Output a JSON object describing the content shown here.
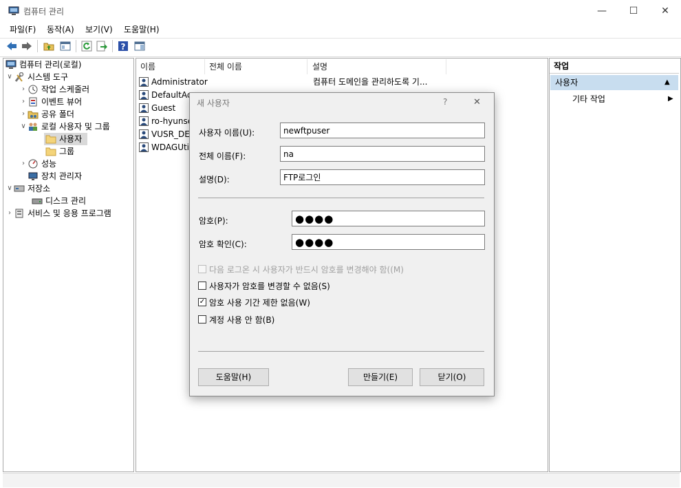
{
  "window": {
    "title": "컴퓨터 관리"
  },
  "window_controls": {
    "minimize": "—",
    "maximize": "☐",
    "close": "✕"
  },
  "menu": [
    "파일(F)",
    "동작(A)",
    "보기(V)",
    "도움말(H)"
  ],
  "tree": [
    {
      "label": "컴퓨터 관리(로컬)",
      "arrow": "",
      "icon": "computer-management-icon"
    },
    {
      "label": "시스템 도구",
      "arrow": "∨",
      "icon": "tools-icon"
    },
    {
      "label": "작업 스케줄러",
      "arrow": "›",
      "icon": "clock-icon"
    },
    {
      "label": "이벤트 뷰어",
      "arrow": "›",
      "icon": "event-viewer-icon"
    },
    {
      "label": "공유 폴더",
      "arrow": "›",
      "icon": "shared-folder-icon"
    },
    {
      "label": "로컬 사용자 및 그룹",
      "arrow": "∨",
      "icon": "users-group-icon"
    },
    {
      "label": "사용자",
      "arrow": "",
      "icon": "folder-icon"
    },
    {
      "label": "그룹",
      "arrow": "",
      "icon": "folder-icon"
    },
    {
      "label": "성능",
      "arrow": "›",
      "icon": "performance-icon"
    },
    {
      "label": "장치 관리자",
      "arrow": "",
      "icon": "device-manager-icon"
    },
    {
      "label": "저장소",
      "arrow": "∨",
      "icon": "storage-icon"
    },
    {
      "label": "디스크 관리",
      "arrow": "",
      "icon": "disk-icon"
    },
    {
      "label": "서비스 및 응용 프로그램",
      "arrow": "›",
      "icon": "services-icon"
    }
  ],
  "list": {
    "columns": [
      "이름",
      "전체 이름",
      "설명"
    ],
    "rows": [
      {
        "name": "Administrator",
        "description": "컴퓨터 도메인을 관리하도록 기..."
      },
      {
        "name": "DefaultAcc"
      },
      {
        "name": "Guest"
      },
      {
        "name": "ro-hyunse"
      },
      {
        "name": "VUSR_DES"
      },
      {
        "name": "WDAGUtil"
      }
    ]
  },
  "actions": {
    "header": "작업",
    "section": "사용자",
    "section_arrow": "▲",
    "item": "기타 작업",
    "item_arrow": "▶"
  },
  "dialog": {
    "title": "새 사용자",
    "help_glyph": "?",
    "close_glyph": "✕",
    "username_label": "사용자 이름(U):",
    "username_value": "newftpuser",
    "fullname_label": "전체 이름(F):",
    "fullname_value": "na",
    "description_label": "설명(D):",
    "description_value": "FTP로그인",
    "password_label": "암호(P):",
    "password_value": "●●●●",
    "confirm_label": "암호 확인(C):",
    "confirm_value": "●●●●",
    "checkboxes": [
      {
        "label": "다음 로그온 시 사용자가 반드시 암호를 변경해야 함((M)",
        "checked": false,
        "disabled": true
      },
      {
        "label": "사용자가 암호를 변경할 수 없음(S)",
        "checked": false,
        "disabled": false
      },
      {
        "label": "암호 사용 기간 제한 없음(W)",
        "checked": true,
        "disabled": false
      },
      {
        "label": "계정 사용 안 함(B)",
        "checked": false,
        "disabled": false
      }
    ],
    "check_glyph": "✓",
    "help_button": "도움말(H)",
    "create_button": "만들기(E)",
    "close_button": "닫기(O)"
  }
}
